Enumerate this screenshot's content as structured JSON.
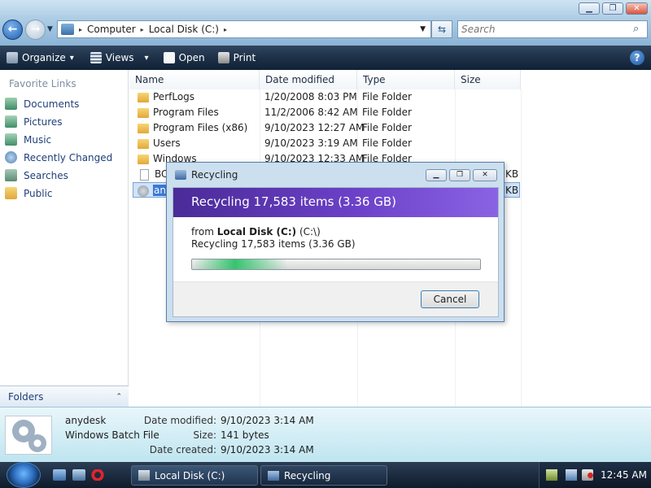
{
  "window": {
    "minimize": "▁",
    "maximize": "❐",
    "close": "✕"
  },
  "address": {
    "crumbs": [
      "Computer",
      "Local Disk (C:)"
    ],
    "separator": "▸",
    "search_placeholder": "Search"
  },
  "toolbar": {
    "organize": "Organize",
    "views": "Views",
    "open": "Open",
    "print": "Print",
    "dropdown": "▾",
    "help": "?"
  },
  "nav": {
    "header": "Favorite Links",
    "items": [
      {
        "label": "Documents",
        "icon": "documents-icon"
      },
      {
        "label": "Pictures",
        "icon": "pictures-icon"
      },
      {
        "label": "Music",
        "icon": "music-icon"
      },
      {
        "label": "Recently Changed",
        "icon": "recently-changed-icon"
      },
      {
        "label": "Searches",
        "icon": "searches-icon"
      },
      {
        "label": "Public",
        "icon": "public-icon"
      }
    ],
    "folders_label": "Folders",
    "folders_chevron": "⌃"
  },
  "list": {
    "columns": [
      "Name",
      "Date modified",
      "Type",
      "Size"
    ],
    "rows": [
      {
        "name": "PerfLogs",
        "date": "1/20/2008 8:03 PM",
        "type": "File Folder",
        "size": ""
      },
      {
        "name": "Program Files",
        "date": "11/2/2006 8:42 AM",
        "type": "File Folder",
        "size": ""
      },
      {
        "name": "Program Files (x86)",
        "date": "9/10/2023 12:27 AM",
        "type": "File Folder",
        "size": ""
      },
      {
        "name": "Users",
        "date": "9/10/2023 3:19 AM",
        "type": "File Folder",
        "size": ""
      },
      {
        "name": "Windows",
        "date": "9/10/2023 12:33 AM",
        "type": "File Folder",
        "size": ""
      },
      {
        "name": "BOO",
        "date": "",
        "type": "",
        "size": "KB"
      },
      {
        "name": "any",
        "date": "",
        "type": "",
        "size": "KB"
      }
    ]
  },
  "dialog": {
    "title": "Recycling",
    "banner": "Recycling 17,583 items (3.36 GB)",
    "from_prefix": "from",
    "from_location": "Local Disk (C:)",
    "from_path": "(C:\\)",
    "status": "Recycling 17,583 items (3.36 GB)",
    "cancel": "Cancel",
    "progress_fraction": 0.33
  },
  "details": {
    "name": "anydesk",
    "type": "Windows Batch File",
    "date_modified_label": "Date modified:",
    "date_modified": "9/10/2023 3:14 AM",
    "size_label": "Size:",
    "size": "141 bytes",
    "date_created_label": "Date created:",
    "date_created": "9/10/2023 3:14 AM"
  },
  "taskbar": {
    "tasks": [
      "Local Disk (C:)",
      "Recycling"
    ],
    "clock": "12:45 AM"
  }
}
